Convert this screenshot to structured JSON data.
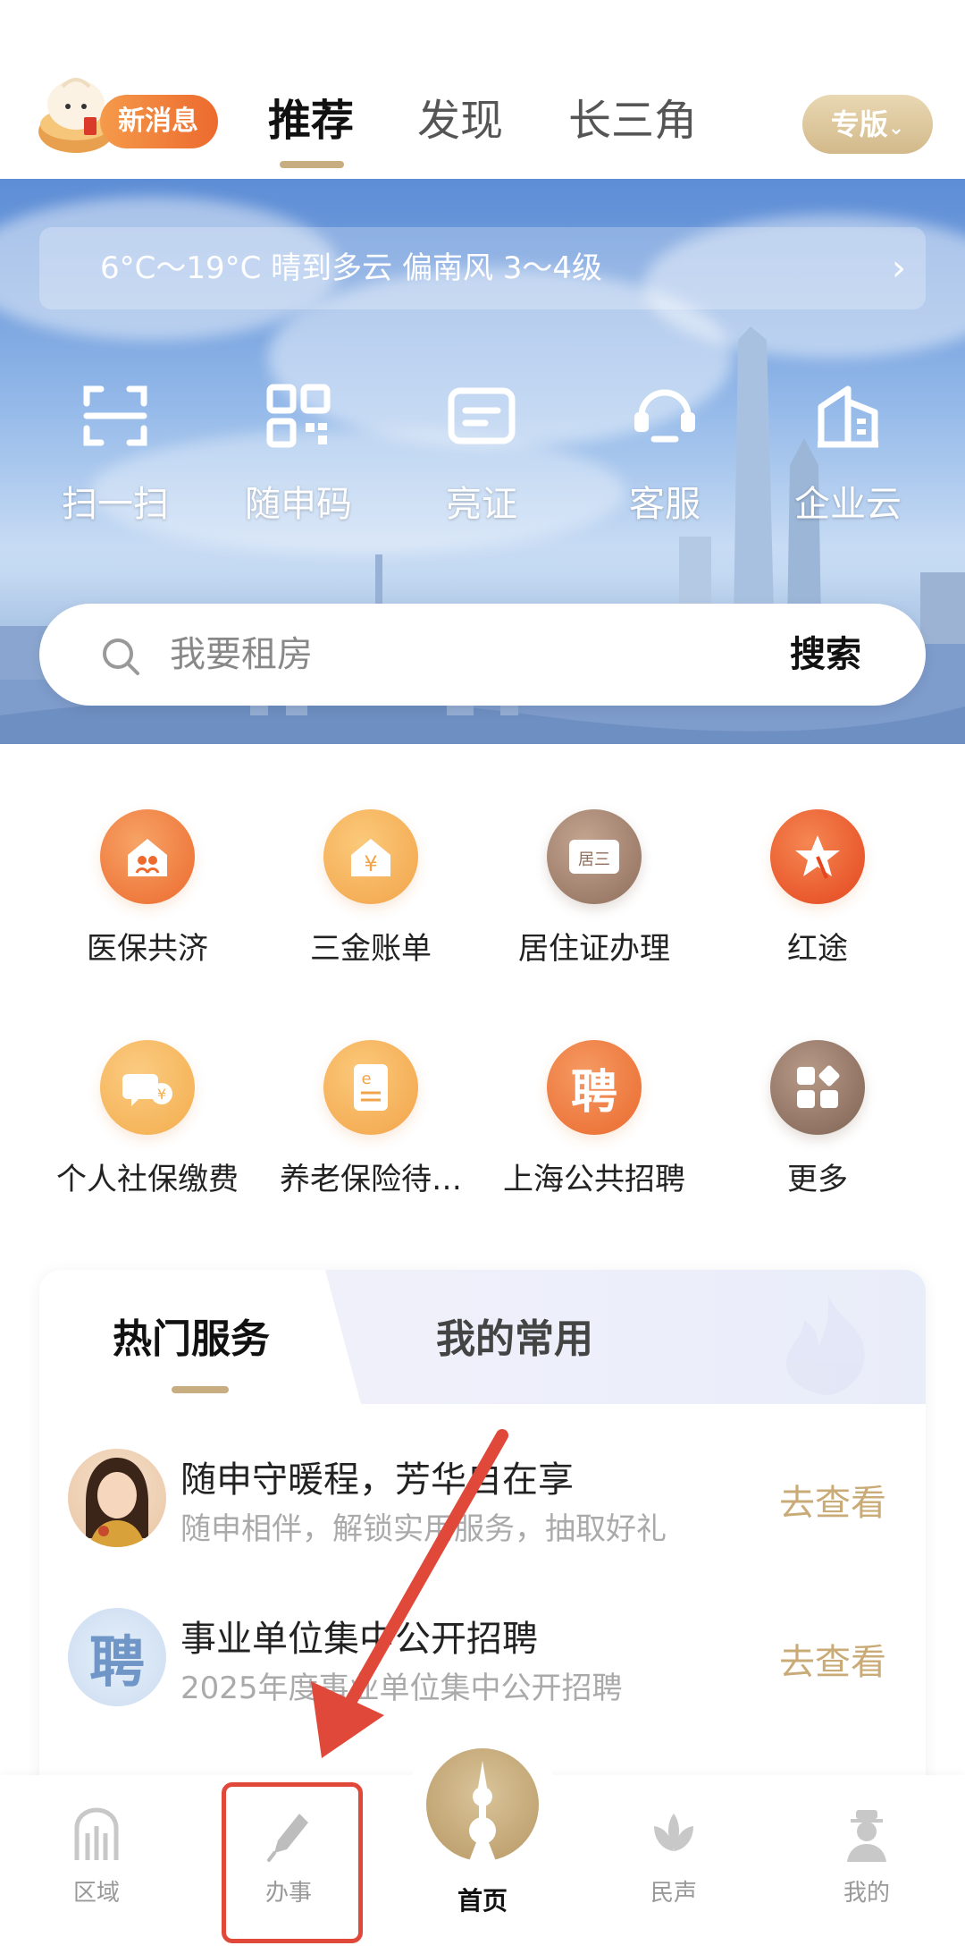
{
  "header": {
    "news_badge": "新消息",
    "tabs": [
      {
        "label": "推荐",
        "active": true
      },
      {
        "label": "发现",
        "active": false
      },
      {
        "label": "长三角",
        "active": false
      }
    ],
    "pro_button": "专版"
  },
  "weather": {
    "text": "6°C～19°C 晴到多云 偏南风 3～4级"
  },
  "quick_actions": [
    {
      "label": "扫一扫",
      "icon": "scan-icon"
    },
    {
      "label": "随申码",
      "icon": "qr-code-icon"
    },
    {
      "label": "亮证",
      "icon": "id-card-icon"
    },
    {
      "label": "客服",
      "icon": "headset-icon"
    },
    {
      "label": "企业云",
      "icon": "building-icon"
    }
  ],
  "search": {
    "placeholder": "我要租房",
    "button": "搜索"
  },
  "services": [
    {
      "label": "医保共济",
      "icon": "family-house-icon",
      "color": "#f07a3a"
    },
    {
      "label": "三金账单",
      "icon": "yuan-house-icon",
      "color": "#f2a44a"
    },
    {
      "label": "居住证办理",
      "icon": "residence-card-icon",
      "color": "#9c7a66"
    },
    {
      "label": "红途",
      "icon": "red-star-icon",
      "color": "#ec5a2a"
    },
    {
      "label": "个人社保缴费",
      "icon": "social-security-icon",
      "color": "#f3ad4c"
    },
    {
      "label": "养老保险待…",
      "icon": "pension-doc-icon",
      "color": "#f2a44a"
    },
    {
      "label": "上海公共招聘",
      "icon": "recruit-icon",
      "color": "#ef7a3c"
    },
    {
      "label": "更多",
      "icon": "more-grid-icon",
      "color": "#8e7464"
    }
  ],
  "service_icon_text": {
    "residence": "居三",
    "recruit": "聘",
    "pension": "e",
    "yuan": "¥"
  },
  "card": {
    "tabs": [
      {
        "label": "热门服务",
        "active": true
      },
      {
        "label": "我的常用",
        "active": false
      }
    ],
    "rows": [
      {
        "title": "随申守暖程，芳华自在享",
        "subtitle": "随申相伴，解锁实用服务，抽取好礼",
        "action": "去查看"
      },
      {
        "title": "事业单位集中公开招聘",
        "subtitle": "2025年度事业单位集中公开招聘",
        "action": "去查看",
        "avatar_text": "聘"
      }
    ]
  },
  "bottom_nav": [
    {
      "label": "区域",
      "icon": "region-icon"
    },
    {
      "label": "办事",
      "icon": "pen-icon"
    },
    {
      "label": "首页",
      "icon": "tower-icon"
    },
    {
      "label": "民声",
      "icon": "lotus-icon"
    },
    {
      "label": "我的",
      "icon": "user-icon"
    }
  ]
}
